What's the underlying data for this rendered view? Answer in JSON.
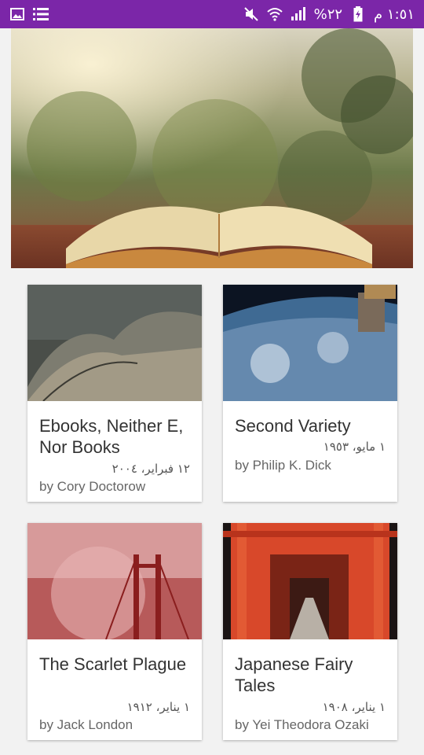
{
  "status_bar": {
    "time": "١:٥١ م",
    "battery": "٢٢%",
    "icons_left": [
      "image-icon",
      "list-icon"
    ],
    "icons_right": [
      "mute-icon",
      "wifi-icon",
      "signal-icon",
      "battery-icon"
    ]
  },
  "hero": {
    "image": "open-book-banner"
  },
  "books": [
    {
      "title": "Second Variety",
      "date": "١ مايو، ١٩٥٣",
      "author": "by Philip K. Dick",
      "image": "earth-from-space"
    },
    {
      "title": "Ebooks, Neither E, Nor Books",
      "date": "١٢ فبراير، ٢٠٠٤",
      "author": "by Cory Doctorow",
      "image": "curved-roof-shells"
    },
    {
      "title": "Japanese Fairy Tales",
      "date": "١ يناير، ١٩٠٨",
      "author": "by Yei Theodora Ozaki",
      "image": "torii-gate-path"
    },
    {
      "title": "The Scarlet Plague",
      "date": "١ يناير، ١٩١٢",
      "author": "by Jack London",
      "image": "bridge-in-red-fog"
    }
  ],
  "colors": {
    "status_bar": "#7b26a8",
    "background": "#f2f2f2",
    "card": "#ffffff"
  }
}
